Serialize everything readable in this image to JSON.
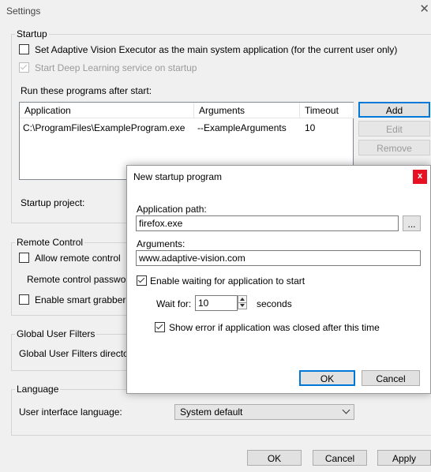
{
  "window": {
    "title": "Settings",
    "close_glyph": "✕"
  },
  "startup": {
    "legend": "Startup",
    "main_app_label": "Set Adaptive Vision Executor as the main system application (for the current user only)",
    "main_app_checked": false,
    "deep_learning_label": "Start Deep Learning service on startup",
    "deep_learning_checked": true,
    "run_programs_label": "Run these programs after start:",
    "table": {
      "columns": [
        "Application",
        "Arguments",
        "Timeout"
      ],
      "rows": [
        {
          "application": "C:\\ProgramFiles\\ExampleProgram.exe",
          "arguments": "--ExampleArguments",
          "timeout": "10"
        }
      ]
    },
    "buttons": {
      "add": "Add",
      "edit": "Edit",
      "remove": "Remove"
    },
    "startup_project_label": "Startup project:"
  },
  "remote_control": {
    "legend": "Remote Control",
    "allow_label": "Allow remote control",
    "allow_checked": false,
    "password_label": "Remote control password:",
    "smart_grabber_label": "Enable smart grabber",
    "smart_grabber_checked": false
  },
  "global_filters": {
    "legend": "Global User Filters",
    "directory_label": "Global User Filters directory:"
  },
  "language": {
    "legend": "Language",
    "ui_language_label": "User interface language:",
    "ui_language_value": "System default"
  },
  "footer": {
    "ok": "OK",
    "cancel": "Cancel",
    "apply": "Apply"
  },
  "dialog": {
    "title": "New startup program",
    "close_glyph": "x",
    "app_path_label": "Application path:",
    "app_path_value": "firefox.exe",
    "browse_label": "...",
    "arguments_label": "Arguments:",
    "arguments_value": "www.adaptive-vision.com",
    "enable_waiting_label": "Enable waiting for application to start",
    "enable_waiting_checked": true,
    "wait_for_label": "Wait for:",
    "wait_for_value": "10",
    "seconds_label": "seconds",
    "show_error_label": "Show error if application was closed after this time",
    "show_error_checked": true,
    "ok": "OK",
    "cancel": "Cancel"
  }
}
